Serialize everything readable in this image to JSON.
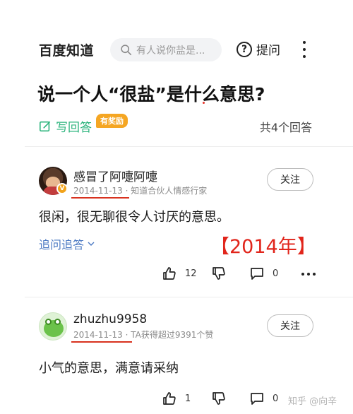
{
  "header": {
    "brand": "百度知道",
    "search_placeholder": "有人说你盐是...",
    "ask_label": "提问"
  },
  "question": {
    "title": "说一个人“很盐”是什么意思?",
    "write_answer_label": "写回答",
    "reward_badge": "有奖励",
    "answer_count": "共4个回答"
  },
  "answers": [
    {
      "username": "感冒了阿嚏阿嚏",
      "date": "2014-11-13",
      "meta": "· 知道合伙人情感行家",
      "follow_label": "关注",
      "text": "很闲，很无聊很令人讨厌的意思。",
      "followup_label": "追问追答",
      "likes": "12",
      "comments": "0"
    },
    {
      "username": "zhuzhu9958",
      "date": "2014-11-13",
      "meta": "· TA获得超过9391个赞",
      "follow_label": "关注",
      "text": "小气的意思，满意请采纳",
      "likes": "1",
      "comments": "0"
    }
  ],
  "annotation": "【2014年】",
  "watermark": "知乎 @向辛",
  "colors": {
    "accent_green": "#2db47d",
    "link_blue": "#4a78c2",
    "annotation_red": "#e1251b",
    "reward_orange": "#f5a623"
  }
}
